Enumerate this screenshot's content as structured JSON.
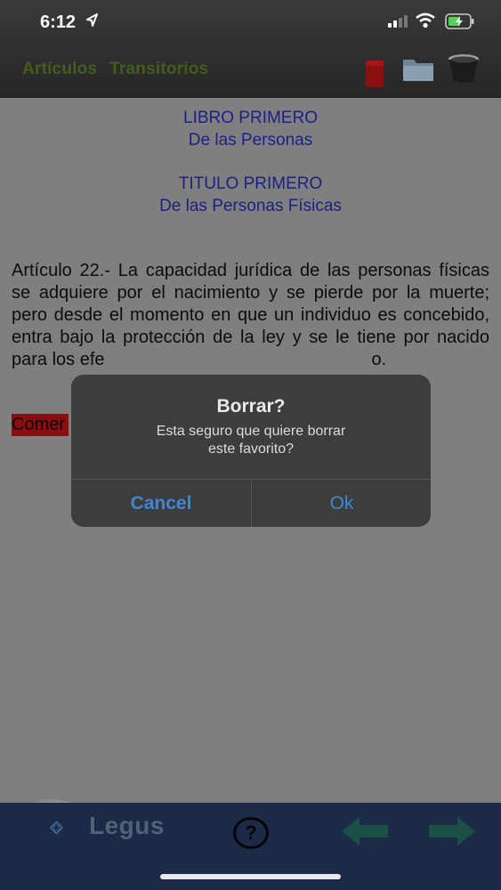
{
  "status": {
    "time": "6:12"
  },
  "toolbar": {
    "links": [
      "Artículos",
      "Transitorios"
    ],
    "icons": [
      "bookmark-icon",
      "folder-icon",
      "trash-icon"
    ]
  },
  "content": {
    "heading1": {
      "line1": "LIBRO PRIMERO",
      "line2": "De las Personas"
    },
    "heading2": {
      "line1": "TITULO PRIMERO",
      "line2": "De las Personas Físicas"
    },
    "article_text": "Artículo 22.- La capacidad jurídica de las personas físicas se adquiere por el nacimiento y se pierde por la muerte; pero desde el momento en que un individuo es concebido, entra bajo la protección de la ley y se le tiene por nacido para los efe",
    "article_tail": "o.",
    "comment_label": "Comer"
  },
  "dialog": {
    "title": "Borrar?",
    "message_line1": "Esta seguro que quiere borrar",
    "message_line2": "este favorito?",
    "cancel": "Cancel",
    "ok": "Ok"
  },
  "bottombar": {
    "logo_text": "Legus",
    "help_label": "?"
  },
  "colors": {
    "heading": "#1d1f86",
    "link": "#465c1e",
    "dialog_button": "#3e86d6",
    "bottombar": "#1a2a47"
  }
}
